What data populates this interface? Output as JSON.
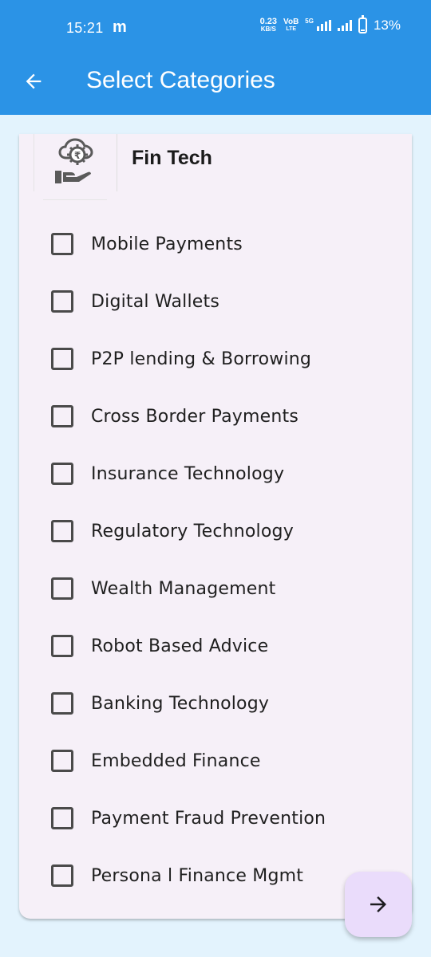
{
  "status": {
    "time": "15:21",
    "app_indicator": "m",
    "net_speed_value": "0.23",
    "net_speed_unit": "KB/S",
    "volte_top": "VoB",
    "volte_bottom": "LTE",
    "network": "5G",
    "battery": "13%",
    "battery_level": 0.13
  },
  "header": {
    "title": "Select Categories",
    "back_icon": "arrow-left-icon"
  },
  "category": {
    "name": "Fin Tech",
    "icon": "fintech-hand-coin-icon"
  },
  "options": [
    {
      "label": "Mobile Payments",
      "checked": false
    },
    {
      "label": "Digital Wallets",
      "checked": false
    },
    {
      "label": "P2P lending & Borrowing",
      "checked": false
    },
    {
      "label": "Cross Border Payments",
      "checked": false
    },
    {
      "label": "Insurance Technology",
      "checked": false
    },
    {
      "label": "Regulatory Technology",
      "checked": false
    },
    {
      "label": "Wealth Management",
      "checked": false
    },
    {
      "label": "Robot Based Advice",
      "checked": false
    },
    {
      "label": "Banking Technology",
      "checked": false
    },
    {
      "label": "Embedded Finance",
      "checked": false
    },
    {
      "label": "Payment Fraud Prevention",
      "checked": false
    },
    {
      "label": "Persona l Finance Mgmt",
      "checked": false
    }
  ],
  "fab": {
    "icon": "arrow-right-icon"
  },
  "colors": {
    "app_bar": "#2B93E6",
    "background": "#E3F3FD",
    "card": "#F6F0F8",
    "fab": "#EADCFB"
  }
}
